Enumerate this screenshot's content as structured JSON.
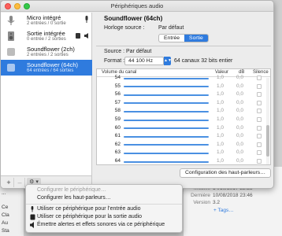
{
  "window": {
    "title": "Périphériques audio"
  },
  "devices": [
    {
      "name": "Micro intégré",
      "sub": "2 entrées / 0 sortie",
      "icon": "microphone-icon",
      "selected": false
    },
    {
      "name": "Sortie intégrée",
      "sub": "0 entrée / 2 sorties",
      "icon": "speaker-icon",
      "selected": false
    },
    {
      "name": "Soundflower (2ch)",
      "sub": "2 entrées / 2 sorties",
      "icon": "generic-audio-icon",
      "selected": false
    },
    {
      "name": "Soundflower (64ch)",
      "sub": "64 entrées / 64 sorties",
      "icon": "generic-audio-icon",
      "selected": true
    }
  ],
  "sidebar_footer": {
    "add": "+",
    "remove": "–",
    "gear": "⚙︎ ▾"
  },
  "detail": {
    "device_title": "Soundflower (64ch)",
    "clock_label": "Horloge source :",
    "clock_value": "Par défaut",
    "tab_input": "Entrée",
    "tab_output": "Sortie",
    "source": "Source : Par défaut",
    "format_label": "Format :",
    "format_value": "44 100 Hz",
    "format_desc": "64 canaux 32 bits entier",
    "table_headers": {
      "volume": "Volume du canal",
      "value": "Valeur",
      "db": "dB",
      "mute": "Silence"
    },
    "rows": [
      {
        "ch": "54",
        "val": "1,0",
        "db": "0,0"
      },
      {
        "ch": "55",
        "val": "1,0",
        "db": "0,0"
      },
      {
        "ch": "56",
        "val": "1,0",
        "db": "0,0"
      },
      {
        "ch": "57",
        "val": "1,0",
        "db": "0,0"
      },
      {
        "ch": "58",
        "val": "1,0",
        "db": "0,0"
      },
      {
        "ch": "59",
        "val": "1,0",
        "db": "0,0"
      },
      {
        "ch": "60",
        "val": "1,0",
        "db": "0,0"
      },
      {
        "ch": "61",
        "val": "1,0",
        "db": "0,0"
      },
      {
        "ch": "62",
        "val": "1,0",
        "db": "0,0"
      },
      {
        "ch": "63",
        "val": "1,0",
        "db": "0,0"
      },
      {
        "ch": "64",
        "val": "1,0",
        "db": "0,0"
      }
    ],
    "config_button": "Configuration des haut-parleurs…"
  },
  "menu": [
    {
      "label": "Configurer le périphérique…",
      "disabled": true,
      "icon": ""
    },
    {
      "label": "Configurer les haut-parleurs…",
      "disabled": false,
      "icon": ""
    },
    {
      "label": "Utiliser ce périphérique pour l’entrée audio",
      "disabled": false,
      "icon": "microphone-icon"
    },
    {
      "label": "Utiliser ce périphérique pour la sortie audio",
      "disabled": false,
      "icon": "speaker-icon"
    },
    {
      "label": "Émettre alertes et effets sonores via ce périphérique",
      "disabled": false,
      "icon": "alert-speaker-icon"
    }
  ],
  "background": {
    "left_fragments": [
      "...",
      "Ce",
      "Cla",
      "Au",
      "Sta"
    ],
    "info_rows": [
      {
        "key": "Modifié",
        "value": "14/10/2017 22:23"
      },
      {
        "key": "Dernière",
        "value": "10/08/2018 23:46"
      },
      {
        "key": "Version",
        "value": "3.2"
      },
      {
        "key": "",
        "value": "+ Tags…"
      }
    ]
  }
}
